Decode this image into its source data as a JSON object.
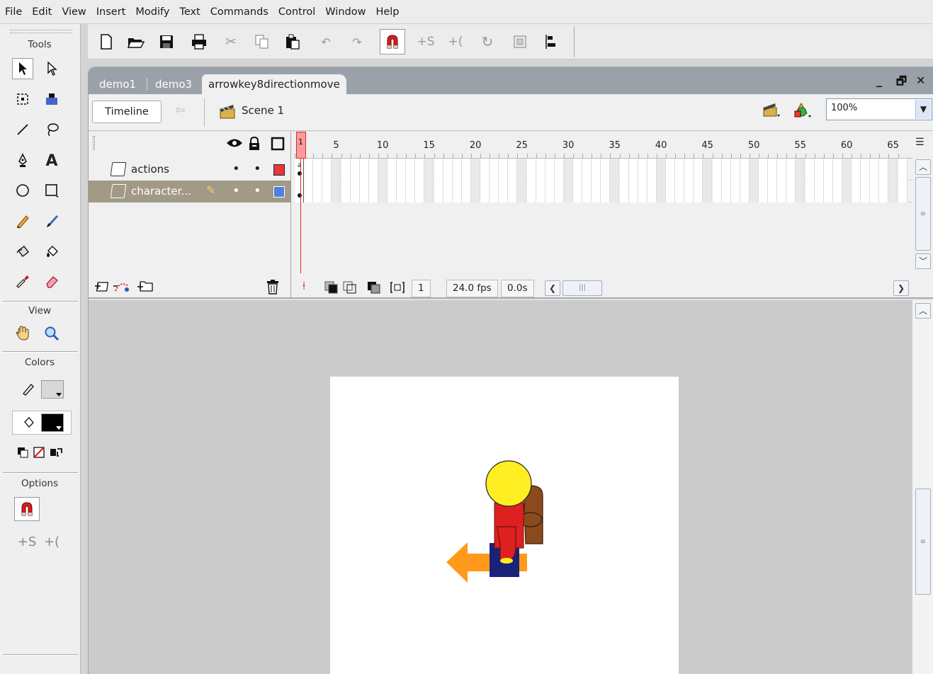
{
  "menu": [
    "File",
    "Edit",
    "View",
    "Insert",
    "Modify",
    "Text",
    "Commands",
    "Control",
    "Window",
    "Help"
  ],
  "tools_panel": {
    "title": "Tools",
    "view_title": "View",
    "colors_title": "Colors",
    "options_title": "Options"
  },
  "document_tabs": [
    "demo1",
    "demo3",
    "arrowkey8directionmove"
  ],
  "active_tab": "arrowkey8directionmove",
  "scene_bar": {
    "timeline_button": "Timeline",
    "scene_label": "Scene 1",
    "zoom_value": "100%"
  },
  "timeline": {
    "ruler_numbers": [
      "1",
      "5",
      "10",
      "15",
      "20",
      "25",
      "30",
      "35",
      "40",
      "45",
      "50",
      "55",
      "60",
      "65"
    ],
    "layers": [
      {
        "name": "actions",
        "color": "#e8373a",
        "selected": false
      },
      {
        "name": "character...",
        "color": "#4f7fe0",
        "selected": true
      }
    ],
    "current_frame": "1",
    "frame_rate": "24.0 fps",
    "elapsed_time": "0.0s"
  },
  "colors": {
    "accent_tab_bar": "#9ba1a8",
    "stage_bg": "#ffffff",
    "pasteboard": "#cbcbcb",
    "character_head": "#ffee22",
    "character_body": "#dd2020",
    "character_bag": "#8b4a1c",
    "character_base": "#1a2277",
    "arrow": "#ff9a1a"
  }
}
